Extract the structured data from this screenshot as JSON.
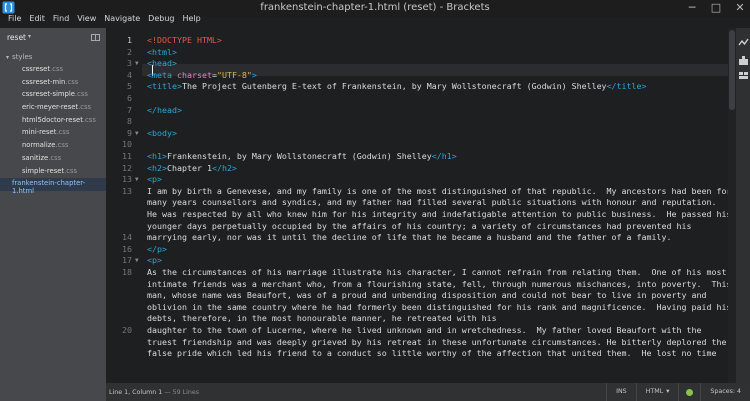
{
  "window": {
    "title": "frankenstein-chapter-1.html (reset) - Brackets"
  },
  "menu": [
    "File",
    "Edit",
    "Find",
    "View",
    "Navigate",
    "Debug",
    "Help"
  ],
  "sidebar": {
    "project": "reset",
    "folder": "styles",
    "files": [
      {
        "name": "cssreset",
        "ext": ".css"
      },
      {
        "name": "cssreset-min",
        "ext": ".css"
      },
      {
        "name": "cssreset-simple",
        "ext": ".css"
      },
      {
        "name": "eric-meyer-reset",
        "ext": ".css"
      },
      {
        "name": "html5doctor-reset",
        "ext": ".css"
      },
      {
        "name": "mini-reset",
        "ext": ".css"
      },
      {
        "name": "normalize",
        "ext": ".css"
      },
      {
        "name": "sanitize",
        "ext": ".css"
      },
      {
        "name": "simple-reset",
        "ext": ".css"
      }
    ],
    "selected_file": {
      "name": "frankenstein-chapter-1",
      "ext": ".html"
    }
  },
  "editor": {
    "lines": [
      {
        "num": "1",
        "fold": "",
        "html": "<span class=\"doctype\">&lt;!DOCTYPE HTML&gt;</span>"
      },
      {
        "num": "2",
        "fold": "",
        "html": "<span class=\"tag\">&lt;html&gt;</span>"
      },
      {
        "num": "3",
        "fold": "▼",
        "html": "<span class=\"tag\">&lt;head&gt;</span>"
      },
      {
        "num": "4",
        "fold": "",
        "html": "<span class=\"tag\">&lt;meta</span> <span class=\"attr\">charset</span>=<span class=\"str\">\"UTF-8\"</span><span class=\"tag\">&gt;</span>"
      },
      {
        "num": "5",
        "fold": "",
        "html": "<span class=\"tag\">&lt;title&gt;</span>The Project Gutenberg E-text of Frankenstein, by Mary Wollstonecraft (Godwin) Shelley<span class=\"tag\">&lt;/title&gt;</span>"
      },
      {
        "num": "6",
        "fold": "",
        "html": ""
      },
      {
        "num": "7",
        "fold": "",
        "html": "<span class=\"tag\">&lt;/head&gt;</span>"
      },
      {
        "num": "8",
        "fold": "",
        "html": ""
      },
      {
        "num": "9",
        "fold": "▼",
        "html": "<span class=\"tag\">&lt;body&gt;</span>"
      },
      {
        "num": "10",
        "fold": "",
        "html": ""
      },
      {
        "num": "11",
        "fold": "",
        "html": "<span class=\"tag\">&lt;h1&gt;</span>Frankenstein, by Mary Wollstonecraft (Godwin) Shelley<span class=\"tag\">&lt;/h1&gt;</span>"
      },
      {
        "num": "12",
        "fold": "",
        "html": "<span class=\"tag\">&lt;h2&gt;</span>Chapter 1<span class=\"tag\">&lt;/h2&gt;</span>"
      },
      {
        "num": "13",
        "fold": "▼",
        "html": "<span class=\"tag\">&lt;p&gt;</span>"
      },
      {
        "num": "13",
        "fold": "",
        "html": "I am by birth a Genevese, and my family is one of the most distinguished of that republic.  My ancestors had been for many years counsellors and syndics, and my father had filled several public situations with honour and reputation.  He was respected by all who knew him for his integrity and indefatigable attention to public business.  He passed his younger days perpetually occupied by the affairs of his country; a variety of circumstances had prevented his"
      },
      {
        "num": "14",
        "fold": "",
        "html": "marrying early, nor was it until the decline of life that he became a husband and the father of a family.\n<span class=\"tag\">&lt;/p&gt;</span>"
      },
      {
        "num": "16",
        "fold": "",
        "html": ""
      },
      {
        "num": "17",
        "fold": "▼",
        "html": "<span class=\"tag\">&lt;p&gt;</span>"
      },
      {
        "num": "18",
        "fold": "",
        "html": "As the circumstances of his marriage illustrate his character, I cannot refrain from relating them.  One of his most intimate friends was a merchant who, from a flourishing state, fell, through numerous mischances, into poverty.  This man, whose name was Beaufort, was of a proud and unbending disposition and could not bear to live in poverty and oblivion in the same country where he had formerly been distinguished for his rank and magnificence.  Having paid his debts, therefore, in the most honourable manner, he retreated with his"
      },
      {
        "num": "20",
        "fold": "",
        "html": "daughter to the town of Lucerne, where he lived unknown and in wretchedness.  My father loved Beaufort with the truest friendship and was deeply grieved by his retreat in these unfortunate circumstances. He bitterly deplored the false pride which led his friend to a conduct so little worthy of the affection that united them.  He lost no time"
      }
    ]
  },
  "status": {
    "position": "Line 1, Column 1",
    "lines": "— 59 Lines",
    "ins": "INS",
    "mode": "HTML",
    "spaces": "Spaces: 4"
  }
}
